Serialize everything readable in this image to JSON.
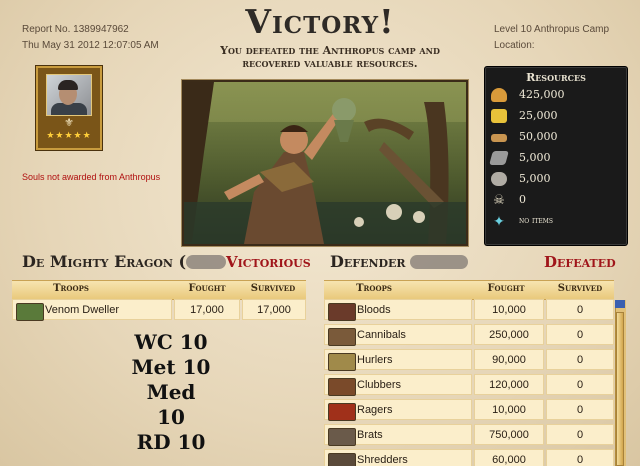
{
  "report": {
    "number": "Report No. 1389947962",
    "date": "Thu May 31 2012 12:07:05 AM"
  },
  "camp": {
    "level": "Level 10 Anthropus Camp",
    "location": "Location:"
  },
  "header": {
    "title": "Victory!",
    "subtitle_line1": "You defeated the Anthropus camp and",
    "subtitle_line2": "recovered valuable resources."
  },
  "player": {
    "stars": "★★★★★",
    "souls_message": "Souls not awarded from Anthropus"
  },
  "resources": {
    "title": "Resources",
    "items": [
      {
        "icon": "food-icon",
        "value": "425,000",
        "color": "#d99a3a"
      },
      {
        "icon": "gold-icon",
        "value": "25,000",
        "color": "#e8c23a"
      },
      {
        "icon": "lumber-icon",
        "value": "50,000",
        "color": "#c99550"
      },
      {
        "icon": "metal-icon",
        "value": "5,000",
        "color": "#9a9a9a"
      },
      {
        "icon": "stone-icon",
        "value": "5,000",
        "color": "#b0aca4"
      },
      {
        "icon": "skull-icon",
        "value": "0",
        "color": "#e0d8c0"
      },
      {
        "icon": "star-item-icon",
        "value": "no items",
        "color": "#6ad0e0"
      }
    ]
  },
  "attacker": {
    "name": "De Mighty Eragon (",
    "result": "Victorious",
    "columns": [
      "Troops",
      "Fought",
      "Survived"
    ],
    "troops": [
      {
        "name": "Venom Dweller",
        "fought": "17,000",
        "survived": "17,000"
      }
    ]
  },
  "defender": {
    "name": "Defender",
    "result": "Defeated",
    "columns": [
      "Troops",
      "Fought",
      "Survived"
    ],
    "troops": [
      {
        "name": "Bloods",
        "fought": "10,000",
        "survived": "0"
      },
      {
        "name": "Cannibals",
        "fought": "250,000",
        "survived": "0"
      },
      {
        "name": "Hurlers",
        "fought": "90,000",
        "survived": "0"
      },
      {
        "name": "Clubbers",
        "fought": "120,000",
        "survived": "0"
      },
      {
        "name": "Ragers",
        "fought": "10,000",
        "survived": "0"
      },
      {
        "name": "Brats",
        "fought": "750,000",
        "survived": "0"
      },
      {
        "name": "Shredders",
        "fought": "60,000",
        "survived": "0"
      }
    ]
  },
  "notes": [
    "WC 10",
    "Met 10",
    "Med 10",
    "RD 10"
  ]
}
